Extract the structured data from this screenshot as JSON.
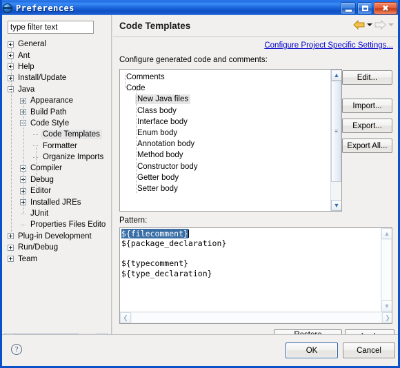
{
  "window": {
    "title": "Preferences",
    "icon": "eclipse-sphere-icon",
    "buttons": {
      "minimize": "minimize-icon",
      "maximize": "maximize-icon",
      "close": "close-icon"
    }
  },
  "sidebar": {
    "filter": {
      "value": "type filter text",
      "placeholder": "type filter text"
    },
    "items": [
      {
        "label": "General",
        "indent": 0,
        "state": "collapsed",
        "selected": false
      },
      {
        "label": "Ant",
        "indent": 0,
        "state": "collapsed",
        "selected": false
      },
      {
        "label": "Help",
        "indent": 0,
        "state": "collapsed",
        "selected": false
      },
      {
        "label": "Install/Update",
        "indent": 0,
        "state": "collapsed",
        "selected": false
      },
      {
        "label": "Java",
        "indent": 0,
        "state": "expanded",
        "selected": false
      },
      {
        "label": "Appearance",
        "indent": 1,
        "state": "collapsed",
        "selected": false
      },
      {
        "label": "Build Path",
        "indent": 1,
        "state": "collapsed",
        "selected": false
      },
      {
        "label": "Code Style",
        "indent": 1,
        "state": "expanded",
        "selected": false
      },
      {
        "label": "Code Templates",
        "indent": 2,
        "state": "leaf",
        "selected": true
      },
      {
        "label": "Formatter",
        "indent": 2,
        "state": "leaf",
        "selected": false
      },
      {
        "label": "Organize Imports",
        "indent": 2,
        "state": "leaf",
        "selected": false
      },
      {
        "label": "Compiler",
        "indent": 1,
        "state": "collapsed",
        "selected": false
      },
      {
        "label": "Debug",
        "indent": 1,
        "state": "collapsed",
        "selected": false
      },
      {
        "label": "Editor",
        "indent": 1,
        "state": "collapsed",
        "selected": false
      },
      {
        "label": "Installed JREs",
        "indent": 1,
        "state": "collapsed",
        "selected": false
      },
      {
        "label": "JUnit",
        "indent": 1,
        "state": "leaf",
        "selected": false
      },
      {
        "label": "Properties Files Edito",
        "indent": 1,
        "state": "leaf",
        "selected": false
      },
      {
        "label": "Plug-in Development",
        "indent": 0,
        "state": "collapsed",
        "selected": false
      },
      {
        "label": "Run/Debug",
        "indent": 0,
        "state": "collapsed",
        "selected": false
      },
      {
        "label": "Team",
        "indent": 0,
        "state": "collapsed",
        "selected": false
      }
    ],
    "hscroll": {
      "left_arrow": "❮",
      "right_arrow": "❯",
      "grip": "❘❘❘"
    }
  },
  "page": {
    "title": "Code Templates",
    "nav": {
      "back_icon": "back-arrow-icon",
      "back_menu_icon": "chevron-down-icon",
      "forward_icon": "forward-arrow-icon",
      "forward_menu_icon": "chevron-down-icon"
    },
    "project_link": "Configure Project Specific Settings...",
    "configure_label": "Configure generated code and comments:"
  },
  "templates_tree": {
    "items": [
      {
        "label": "Comments",
        "indent": 0,
        "state": "collapsed",
        "selected": false
      },
      {
        "label": "Code",
        "indent": 0,
        "state": "expanded",
        "selected": false
      },
      {
        "label": "New Java files",
        "indent": 1,
        "state": "leaf",
        "selected": true
      },
      {
        "label": "Class body",
        "indent": 1,
        "state": "leaf",
        "selected": false
      },
      {
        "label": "Interface body",
        "indent": 1,
        "state": "leaf",
        "selected": false
      },
      {
        "label": "Enum body",
        "indent": 1,
        "state": "leaf",
        "selected": false
      },
      {
        "label": "Annotation body",
        "indent": 1,
        "state": "leaf",
        "selected": false
      },
      {
        "label": "Method body",
        "indent": 1,
        "state": "leaf",
        "selected": false
      },
      {
        "label": "Constructor body",
        "indent": 1,
        "state": "leaf",
        "selected": false
      },
      {
        "label": "Getter body",
        "indent": 1,
        "state": "leaf",
        "selected": false
      },
      {
        "label": "Setter body",
        "indent": 1,
        "state": "leaf",
        "selected": false
      }
    ],
    "scrollbar": {
      "up_arrow": "▲",
      "down_arrow": "▼",
      "grip": "≡"
    }
  },
  "side_buttons": {
    "edit": "Edit...",
    "import": "Import...",
    "export": "Export...",
    "export_all": "Export All..."
  },
  "pattern": {
    "label": "Pattern:",
    "selected_line": "${filecomment}",
    "rest": "${package_declaration}\n\n${typecomment}\n${type_declaration}",
    "scroll_left_arrow": "❮",
    "scroll_right_arrow": "❯",
    "scroll_up_arrow": "▲",
    "scroll_down_arrow": "▼"
  },
  "actions": {
    "restore_defaults": "Restore Defaults",
    "apply": "Apply",
    "ok": "OK",
    "cancel": "Cancel",
    "help": "?"
  },
  "colors": {
    "title_bar": "#1b64d6",
    "window_border": "#0a50c8",
    "selection": "#3a6ea5",
    "link": "#0000cc",
    "back_arrow": "#e8a317",
    "close_button": "#e8603a",
    "dialog_bg": "#f1f0ef"
  }
}
